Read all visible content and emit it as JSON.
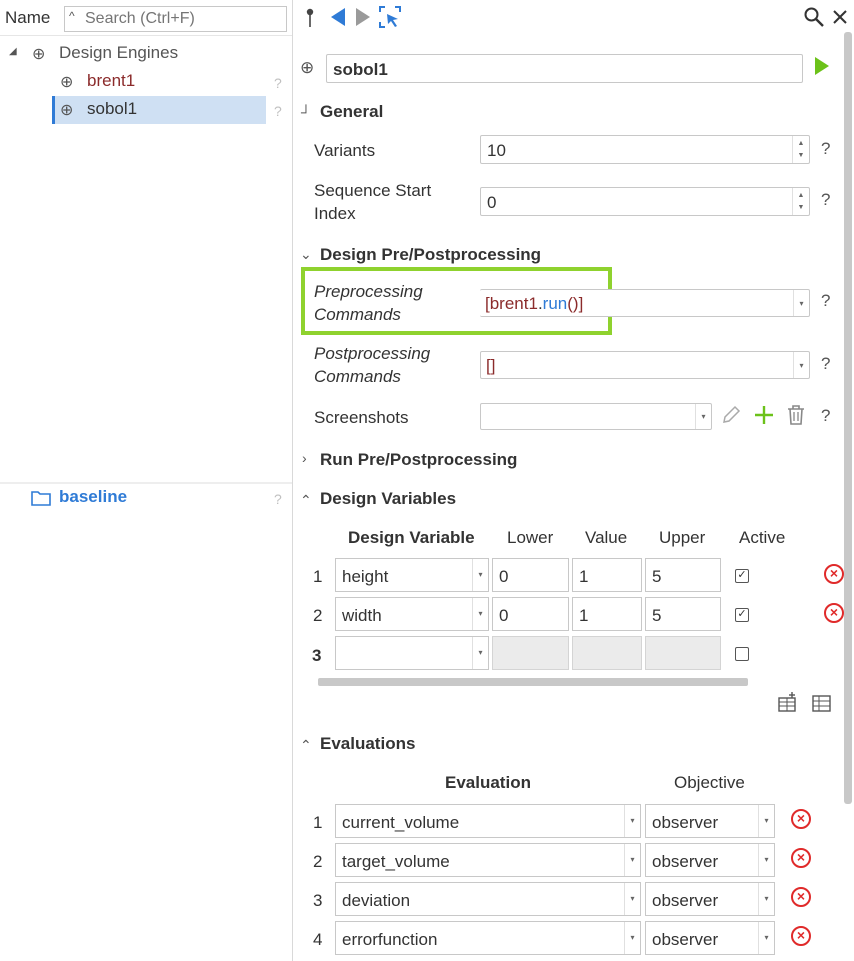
{
  "left_panel": {
    "header_label": "Name",
    "search_placeholder": "Search (Ctrl+F)",
    "tree": {
      "root_label": "Design Engines",
      "items": [
        {
          "label": "brent1",
          "help": "?"
        },
        {
          "label": "sobol1",
          "help": "?"
        }
      ]
    },
    "bottom_item": {
      "label": "baseline",
      "help": "?"
    }
  },
  "toolbar": {
    "pin_icon": "pin-icon",
    "back_icon": "back-arrow-icon",
    "forward_icon": "forward-arrow-icon",
    "select_icon": "select-target-icon",
    "search_icon": "search-icon",
    "close_icon": "close-icon"
  },
  "engine": {
    "name": "sobol1"
  },
  "sections": {
    "general": "General",
    "design_prepost": "Design Pre/Postprocessing",
    "run_prepost": "Run Pre/Postprocessing",
    "design_variables": "Design Variables",
    "evaluations": "Evaluations"
  },
  "general": {
    "variants_label": "Variants",
    "variants_value": "10",
    "seq_label_1": "Sequence Start",
    "seq_label_2": "Index",
    "seq_value": "0"
  },
  "design_prepost": {
    "pre_label_1": "Preprocessing",
    "pre_label_2": "Commands",
    "pre_value_open": "[brent1",
    "pre_value_dot": ".",
    "pre_value_run": "run",
    "pre_value_close": "()]",
    "post_label_1": "Postprocessing",
    "post_label_2": "Commands",
    "post_value": "[]",
    "screenshots_label": "Screenshots"
  },
  "help": "?",
  "design_variables": {
    "columns": [
      "Design Variable",
      "Lower",
      "Value",
      "Upper",
      "Active"
    ],
    "rows": [
      {
        "num": "1",
        "name": "height",
        "lower": "0",
        "value": "1",
        "upper": "5",
        "active": true
      },
      {
        "num": "2",
        "name": "width",
        "lower": "0",
        "value": "1",
        "upper": "5",
        "active": true
      },
      {
        "num": "3",
        "name": "",
        "lower": "",
        "value": "",
        "upper": "",
        "active": false
      }
    ]
  },
  "evaluations": {
    "columns": [
      "Evaluation",
      "Objective"
    ],
    "rows": [
      {
        "num": "1",
        "name": "current_volume",
        "objective": "observer"
      },
      {
        "num": "2",
        "name": "target_volume",
        "objective": "observer"
      },
      {
        "num": "3",
        "name": "deviation",
        "objective": "observer"
      },
      {
        "num": "4",
        "name": "errorfunction",
        "objective": "observer"
      }
    ]
  },
  "colors": {
    "accent_blue": "#2f7bd6",
    "highlight_green": "#8fd22e",
    "run_green": "#6cc21a",
    "delete_red": "#e02a2a",
    "selection_bg": "#cfe0f3",
    "brent_text": "#8b2b2b"
  }
}
